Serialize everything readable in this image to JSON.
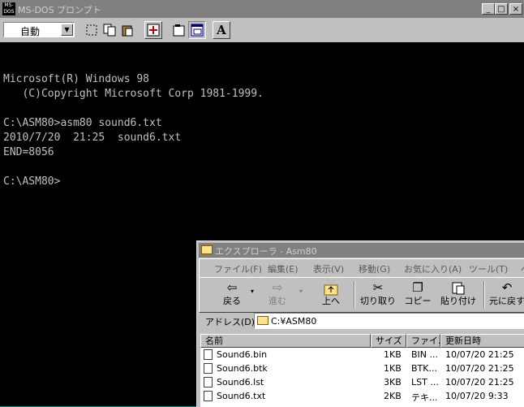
{
  "dos": {
    "title": "MS-DOS プロンプト",
    "icon_label": "MS-DOS",
    "font_select": "自動",
    "window_buttons": {
      "minimize": "_",
      "maximize": "□",
      "close": "×"
    },
    "toolbar_icons": [
      "mark-icon",
      "copy-icon",
      "paste-icon",
      "fullscreen-icon",
      "properties-icon",
      "background-icon",
      "font-icon"
    ],
    "font_button": "A",
    "console_lines": [
      "Microsoft(R) Windows 98",
      "   (C)Copyright Microsoft Corp 1981-1999.",
      "",
      "C:\\ASM80>asm80 sound6.txt",
      "2010/7/20  21:25  sound6.txt",
      "END=8056",
      "",
      "C:\\ASM80>"
    ]
  },
  "explorer": {
    "title": "エクスプローラ - Asm80",
    "menu": [
      "ファイル(F)",
      "編集(E)",
      "表示(V)",
      "移動(G)",
      "お気に入り(A)",
      "ツール(T)",
      "ヘ"
    ],
    "toolbar": [
      {
        "label": "戻る",
        "icon": "back-icon",
        "glyph": "⇦"
      },
      {
        "label": "進む",
        "icon": "forward-icon",
        "glyph": "⇨"
      },
      {
        "label": "上へ",
        "icon": "up-folder-icon",
        "glyph": "▲"
      },
      {
        "label": "切り取り",
        "icon": "cut-icon",
        "glyph": "✂"
      },
      {
        "label": "コピー",
        "icon": "copy-icon",
        "glyph": "❐"
      },
      {
        "label": "貼り付け",
        "icon": "paste-icon",
        "glyph": "📋"
      },
      {
        "label": "元に戻す",
        "icon": "undo-icon",
        "glyph": "↶"
      }
    ],
    "address_label": "アドレス(D)",
    "address_value": "C:¥ASM80",
    "columns": [
      "名前",
      "サイズ",
      "ファイ...",
      "更新日時"
    ],
    "files": [
      {
        "name": "Sound6.bin",
        "size": "1KB",
        "type": "BIN ...",
        "modified": "10/07/20 21:25"
      },
      {
        "name": "Sound6.btk",
        "size": "1KB",
        "type": "BTK...",
        "modified": "10/07/20 21:25"
      },
      {
        "name": "Sound6.lst",
        "size": "3KB",
        "type": "LST ...",
        "modified": "10/07/20 21:25"
      },
      {
        "name": "Sound6.txt",
        "size": "2KB",
        "type": "テキ...",
        "modified": "10/07/20 9:33"
      }
    ]
  }
}
